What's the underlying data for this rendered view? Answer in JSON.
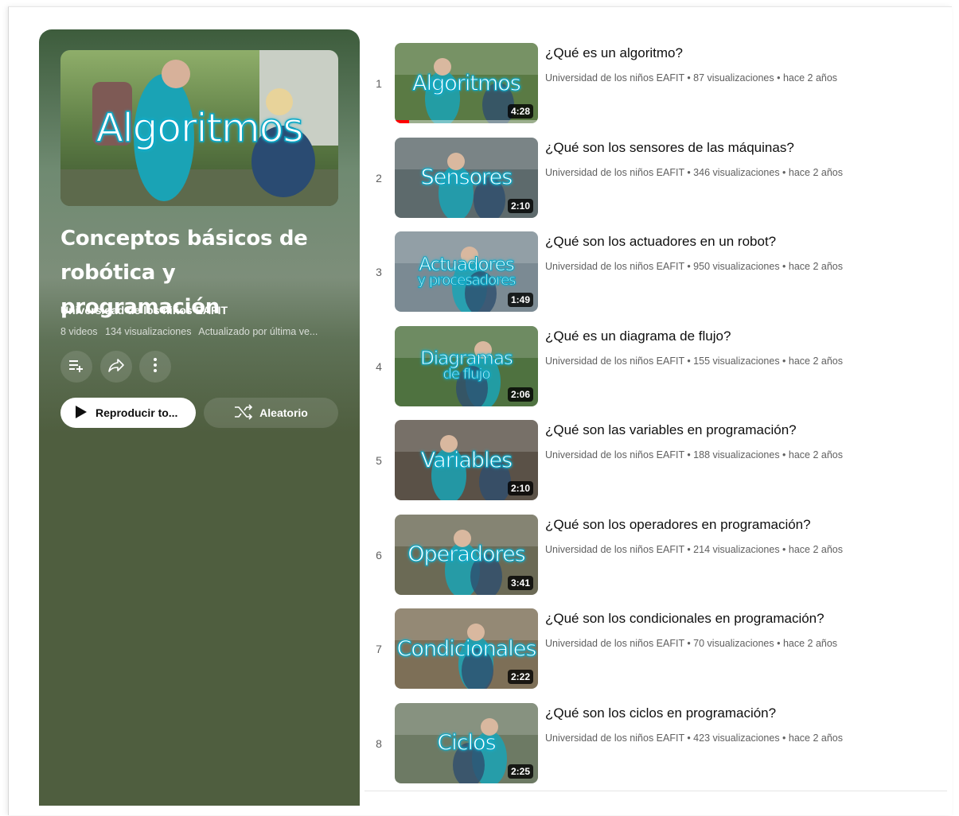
{
  "playlist": {
    "hero_text": "Algoritmos",
    "title": "Conceptos básicos de robótica y programación",
    "channel": "Universidad de los niños EAFIT",
    "video_count": "8 videos",
    "views": "134 visualizaciones",
    "updated": "Actualizado por última ve...",
    "play_label": "Reproducir to...",
    "shuffle_label": "Aleatorio",
    "icons": [
      "add-to-queue-icon",
      "share-icon",
      "more-vert-icon",
      "play-icon",
      "shuffle-icon"
    ]
  },
  "videos": [
    {
      "index": "1",
      "title": "¿Qué es un algoritmo?",
      "meta": "Universidad de los niños EAFIT • 87 visualizaciones • hace 2 años",
      "duration": "4:28",
      "thumb_text": "Algoritmos",
      "thumb_color": "#5a7a44"
    },
    {
      "index": "2",
      "title": "¿Qué son los sensores de las máquinas?",
      "meta": "Universidad de los niños EAFIT • 346 visualizaciones • hace 2 años",
      "duration": "2:10",
      "thumb_text": "Sensores",
      "thumb_color": "#5d6a6c"
    },
    {
      "index": "3",
      "title": "¿Qué son los actuadores en un robot?",
      "meta": "Universidad de los niños EAFIT • 950 visualizaciones • hace 2 años",
      "duration": "1:49",
      "thumb_text": "Actuadores",
      "thumb_text2": "y procesadores",
      "thumb_color": "#7b8a93"
    },
    {
      "index": "4",
      "title": "¿Qué es un diagrama de flujo?",
      "meta": "Universidad de los niños EAFIT • 155 visualizaciones • hace 2 años",
      "duration": "2:06",
      "thumb_text": "Diagramas",
      "thumb_text2": "de flujo",
      "thumb_color": "#4f7240"
    },
    {
      "index": "5",
      "title": "¿Qué son las variables en programación?",
      "meta": "Universidad de los niños EAFIT • 188 visualizaciones • hace 2 años",
      "duration": "2:10",
      "thumb_text": "Variables",
      "thumb_color": "#5a5147"
    },
    {
      "index": "6",
      "title": "¿Qué son los operadores en programación?",
      "meta": "Universidad de los niños EAFIT • 214 visualizaciones • hace 2 años",
      "duration": "3:41",
      "thumb_text": "Operadores",
      "thumb_color": "#6b6a55"
    },
    {
      "index": "7",
      "title": "¿Qué son los condicionales en programación?",
      "meta": "Universidad de los niños EAFIT • 70 visualizaciones • hace 2 años",
      "duration": "2:22",
      "thumb_text": "Condicionales",
      "thumb_color": "#7d6f57"
    },
    {
      "index": "8",
      "title": "¿Qué son los ciclos en programación?",
      "meta": "Universidad de los niños EAFIT • 423 visualizaciones • hace 2 años",
      "duration": "2:25",
      "thumb_text": "Ciclos",
      "thumb_color": "#6d7a64"
    }
  ]
}
